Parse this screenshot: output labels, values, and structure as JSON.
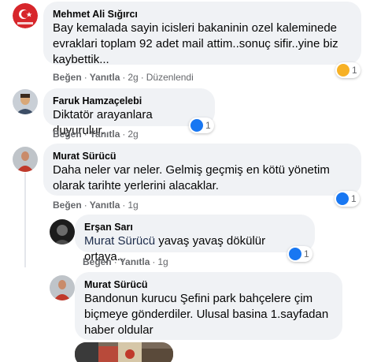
{
  "comments": [
    {
      "author": "Mehmet Ali Sığırcı",
      "text": "Bay kemalada sayin icisleri bakaninin ozel kaleminede evraklari toplam 92 adet mail attim..sonuç sifir..yine biz kaybettik...",
      "like": "Beğen",
      "reply": "Yanıtla",
      "time": "2g",
      "edited": "Düzenlendi",
      "reaction_count": "1",
      "reaction_icon": "sad-icon"
    },
    {
      "author": "Faruk Hamzaçelebi",
      "text": "Diktatör arayanlara duyurulur.",
      "like": "Beğen",
      "reply": "Yanıtla",
      "time": "2g",
      "reaction_count": "1",
      "reaction_icon": "like-icon"
    },
    {
      "author": "Murat Sürücü",
      "text": "Daha neler var neler. Gelmiş geçmiş en kötü yönetim olarak tarihte yerlerini alacaklar.",
      "like": "Beğen",
      "reply": "Yanıtla",
      "time": "1g",
      "reaction_count": "1",
      "reaction_icon": "like-icon"
    }
  ],
  "replies": [
    {
      "author": "Erşan Sarı",
      "mention": "Murat Sürücü",
      "text": " yavaş yavaş dökülür ortaya..",
      "like": "Beğen",
      "reply": "Yanıtla",
      "time": "1g",
      "reaction_count": "1",
      "reaction_icon": "like-icon"
    },
    {
      "author": "Murat Sürücü",
      "text": "Bandonun kurucu Şefini park bahçelere çim biçmeye gönderdiler. Ulusal basina 1.sayfadan haber oldular"
    }
  ],
  "colors": {
    "bubble": "#f0f2f5",
    "like_blue": "#1877f2",
    "sad_yellow": "#f7b125",
    "meta_gray": "#65676b"
  }
}
